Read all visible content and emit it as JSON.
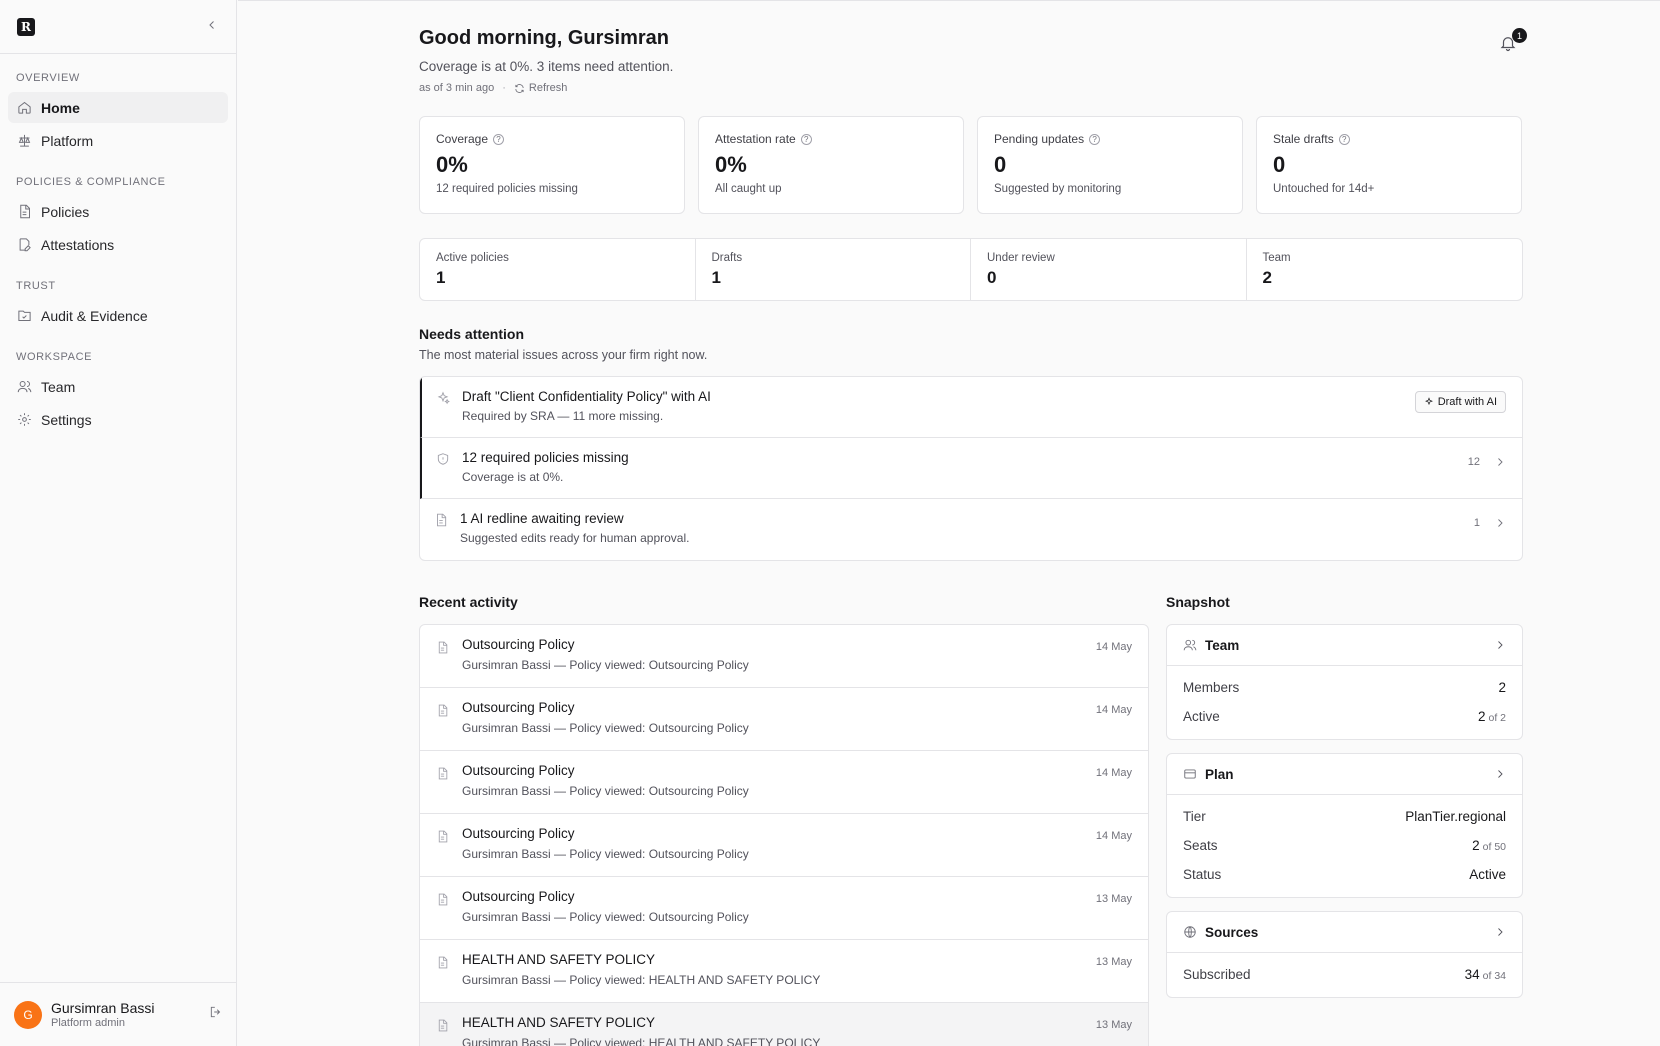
{
  "brand": {
    "logo_letter": "R"
  },
  "sidebar": {
    "groups": [
      {
        "label": "OVERVIEW",
        "items": [
          {
            "label": "Home",
            "icon": "home-icon",
            "active": true
          },
          {
            "label": "Platform",
            "icon": "scale-icon"
          }
        ]
      },
      {
        "label": "POLICIES & COMPLIANCE",
        "items": [
          {
            "label": "Policies",
            "icon": "document-icon"
          },
          {
            "label": "Attestations",
            "icon": "signature-icon"
          }
        ]
      },
      {
        "label": "TRUST",
        "items": [
          {
            "label": "Audit & Evidence",
            "icon": "folder-check-icon"
          }
        ]
      },
      {
        "label": "WORKSPACE",
        "items": [
          {
            "label": "Team",
            "icon": "users-icon"
          },
          {
            "label": "Settings",
            "icon": "gear-icon"
          }
        ]
      }
    ],
    "user": {
      "initial": "G",
      "name": "Gursimran Bassi",
      "role": "Platform admin",
      "avatar_color": "#f97316"
    }
  },
  "header": {
    "greeting": "Good morning, Gursimran",
    "subtitle": "Coverage is at 0%. 3 items need attention.",
    "as_of": "as of 3 min ago",
    "refresh_label": "Refresh",
    "notification_count": "1"
  },
  "kpis": [
    {
      "label": "Coverage",
      "value": "0%",
      "hint": "12 required policies missing"
    },
    {
      "label": "Attestation rate",
      "value": "0%",
      "hint": "All caught up"
    },
    {
      "label": "Pending updates",
      "value": "0",
      "hint": "Suggested by monitoring"
    },
    {
      "label": "Stale drafts",
      "value": "0",
      "hint": "Untouched for 14d+"
    }
  ],
  "stats": [
    {
      "label": "Active policies",
      "value": "1"
    },
    {
      "label": "Drafts",
      "value": "1"
    },
    {
      "label": "Under review",
      "value": "0"
    },
    {
      "label": "Team",
      "value": "2"
    }
  ],
  "attention": {
    "title": "Needs attention",
    "subtitle": "The most material issues across your firm right now.",
    "items": [
      {
        "title": "Draft \"Client Confidentiality Policy\" with AI",
        "sub": "Required by SRA — 11 more missing.",
        "action_label": "Draft with AI",
        "icon": "sparkle-icon"
      },
      {
        "title": "12 required policies missing",
        "sub": "Coverage is at 0%.",
        "count": "12",
        "icon": "shield-icon"
      },
      {
        "title": "1 AI redline awaiting review",
        "sub": "Suggested edits ready for human approval.",
        "count": "1",
        "icon": "document-icon"
      }
    ]
  },
  "activity": {
    "title": "Recent activity",
    "items": [
      {
        "title": "Outsourcing Policy",
        "sub": "Gursimran Bassi — Policy viewed: Outsourcing Policy",
        "date": "14 May"
      },
      {
        "title": "Outsourcing Policy",
        "sub": "Gursimran Bassi — Policy viewed: Outsourcing Policy",
        "date": "14 May"
      },
      {
        "title": "Outsourcing Policy",
        "sub": "Gursimran Bassi — Policy viewed: Outsourcing Policy",
        "date": "14 May"
      },
      {
        "title": "Outsourcing Policy",
        "sub": "Gursimran Bassi — Policy viewed: Outsourcing Policy",
        "date": "14 May"
      },
      {
        "title": "Outsourcing Policy",
        "sub": "Gursimran Bassi — Policy viewed: Outsourcing Policy",
        "date": "13 May"
      },
      {
        "title": "HEALTH AND SAFETY POLICY",
        "sub": "Gursimran Bassi — Policy viewed: HEALTH AND SAFETY POLICY",
        "date": "13 May"
      },
      {
        "title": "HEALTH AND SAFETY POLICY",
        "sub": "Gursimran Bassi — Policy viewed: HEALTH AND SAFETY POLICY",
        "date": "13 May"
      }
    ]
  },
  "snapshot": {
    "title": "Snapshot",
    "team": {
      "title": "Team",
      "members_label": "Members",
      "members_value": "2",
      "active_label": "Active",
      "active_value": "2",
      "active_of": "of 2"
    },
    "plan": {
      "title": "Plan",
      "tier_label": "Tier",
      "tier_value": "PlanTier.regional",
      "seats_label": "Seats",
      "seats_value": "2",
      "seats_of": "of 50",
      "status_label": "Status",
      "status_value": "Active"
    },
    "sources": {
      "title": "Sources",
      "subscribed_label": "Subscribed",
      "subscribed_value": "34",
      "subscribed_of": "of 34"
    }
  }
}
